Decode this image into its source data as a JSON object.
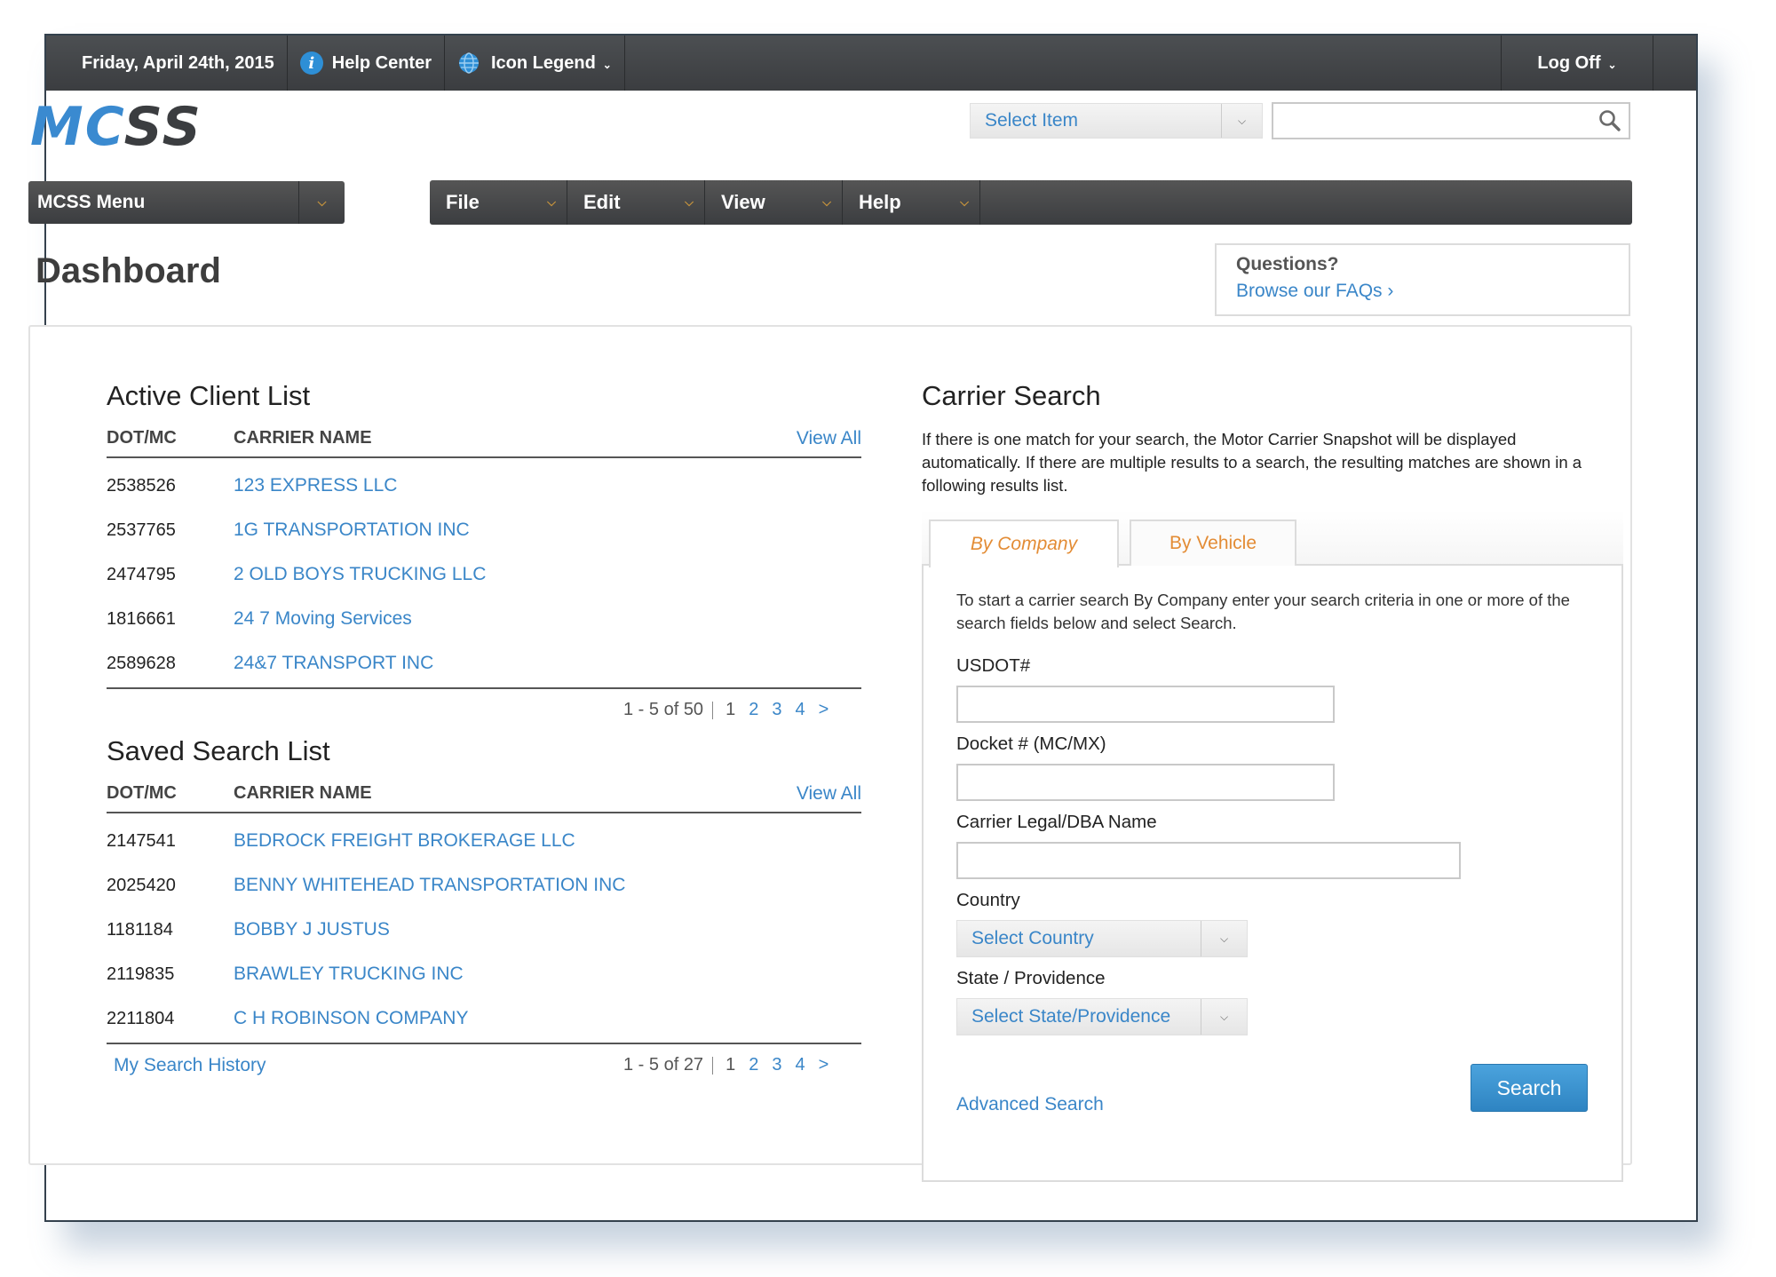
{
  "topbar": {
    "date": "Friday, April 24th, 2015",
    "help_center": "Help Center",
    "icon_legend": "Icon Legend",
    "log_off": "Log Off"
  },
  "logo": {
    "part1": "MC",
    "part2": "SS"
  },
  "header_search": {
    "select_label": "Select Item",
    "query": ""
  },
  "menus": {
    "mcss_menu": "MCSS Menu",
    "items": [
      "File",
      "Edit",
      "View",
      "Help"
    ]
  },
  "page_title": "Dashboard",
  "faq": {
    "question": "Questions?",
    "link": "Browse our FAQs ›"
  },
  "active_client_list": {
    "title": "Active Client List",
    "col1": "DOT/MC",
    "col2": "CARRIER NAME",
    "view_all": "View All",
    "rows": [
      {
        "dot": "2538526",
        "name": "123 EXPRESS LLC"
      },
      {
        "dot": "2537765",
        "name": "1G TRANSPORTATION INC"
      },
      {
        "dot": "2474795",
        "name": "2 OLD BOYS TRUCKING LLC"
      },
      {
        "dot": "1816661",
        "name": "24 7 Moving Services"
      },
      {
        "dot": "2589628",
        "name": "24&7 TRANSPORT INC"
      }
    ],
    "pager": {
      "summary": "1 - 5 of 50",
      "pages": [
        "1",
        "2",
        "3",
        "4"
      ],
      "next": ">"
    }
  },
  "saved_search_list": {
    "title": "Saved Search List",
    "col1": "DOT/MC",
    "col2": "CARRIER NAME",
    "view_all": "View All",
    "rows": [
      {
        "dot": "2147541",
        "name": "BEDROCK FREIGHT BROKERAGE LLC"
      },
      {
        "dot": "2025420",
        "name": "BENNY WHITEHEAD TRANSPORTATION INC"
      },
      {
        "dot": "1181184",
        "name": "BOBBY J JUSTUS"
      },
      {
        "dot": "2119835",
        "name": "BRAWLEY TRUCKING INC"
      },
      {
        "dot": "2211804",
        "name": "C H ROBINSON COMPANY"
      }
    ],
    "history_link": "My Search History",
    "pager": {
      "summary": "1 - 5 of 27",
      "pages": [
        "1",
        "2",
        "3",
        "4"
      ],
      "next": ">"
    }
  },
  "carrier_search": {
    "title": "Carrier Search",
    "description": "If there is one match for your search, the Motor Carrier Snapshot will be displayed automatically. If there are multiple results to a search, the resulting matches are shown in a following results list.",
    "tabs": [
      "By Company",
      "By Vehicle"
    ],
    "intro": "To start a carrier search By Company enter your search criteria in one or more of the search fields below and select Search.",
    "usdot_label": "USDOT#",
    "usdot_value": "",
    "docket_label": "Docket # (MC/MX)",
    "docket_value": "",
    "name_label": "Carrier Legal/DBA Name",
    "name_value": "",
    "country_label": "Country",
    "country_select": "Select Country",
    "state_label": "State / Providence",
    "state_select": "Select State/Providence",
    "advanced_link": "Advanced Search",
    "search_button": "Search"
  },
  "colors": {
    "accent_blue": "#3a86c8",
    "tab_orange": "#e38c35",
    "bar_dark": "#3b3d40"
  }
}
